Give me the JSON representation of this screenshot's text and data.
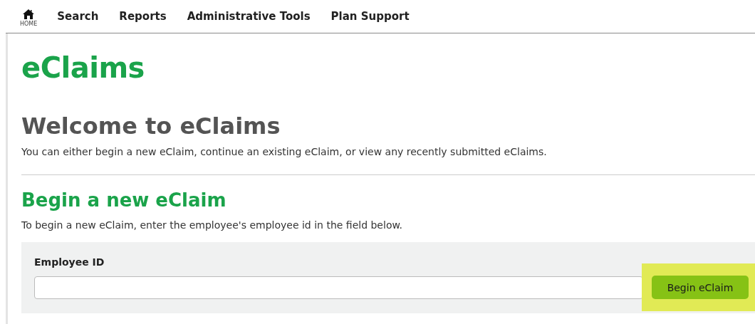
{
  "nav": {
    "home_label": "HOME",
    "items": [
      {
        "label": "Search"
      },
      {
        "label": "Reports"
      },
      {
        "label": "Administrative Tools"
      },
      {
        "label": "Plan Support"
      }
    ]
  },
  "app_title": "eClaims",
  "welcome": {
    "heading": "Welcome to eClaims",
    "text": "You can either begin a new eClaim, continue an existing eClaim, or view any recently submitted eClaims."
  },
  "begin_section": {
    "heading": "Begin a new eClaim",
    "text": "To begin a new eClaim, enter the employee's employee id in the field below.",
    "form": {
      "label": "Employee ID",
      "button": {
        "label": "Begin eClaim",
        "highlighted": true
      }
    }
  }
}
